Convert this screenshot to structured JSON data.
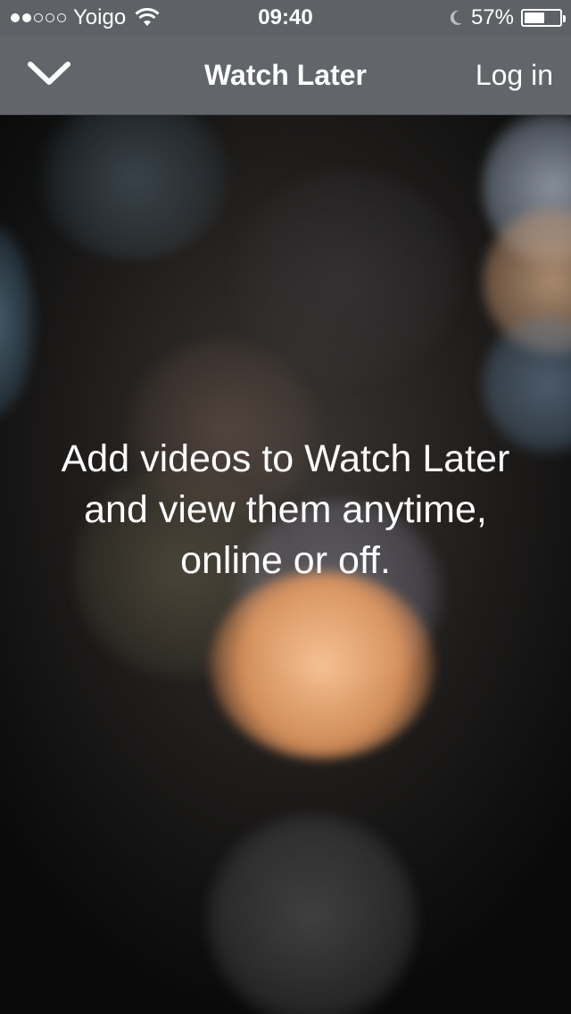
{
  "status_bar": {
    "carrier": "Yoigo",
    "signal_bars_filled": 2,
    "signal_bars_total": 5,
    "time": "09:40",
    "battery_percent_label": "57%",
    "battery_level": 0.57,
    "icons": [
      "signal-dots-icon",
      "wifi-icon",
      "moon-icon",
      "battery-icon"
    ]
  },
  "nav": {
    "back_icon": "chevron-down-icon",
    "title": "Watch Later",
    "login_label": "Log in"
  },
  "empty_state": {
    "lines": [
      "Add videos to Watch Later",
      "and view them anytime,",
      "online or off."
    ]
  },
  "colors": {
    "bar_background": "#62656a",
    "status_background": "#5e6166",
    "text": "#ffffff"
  }
}
